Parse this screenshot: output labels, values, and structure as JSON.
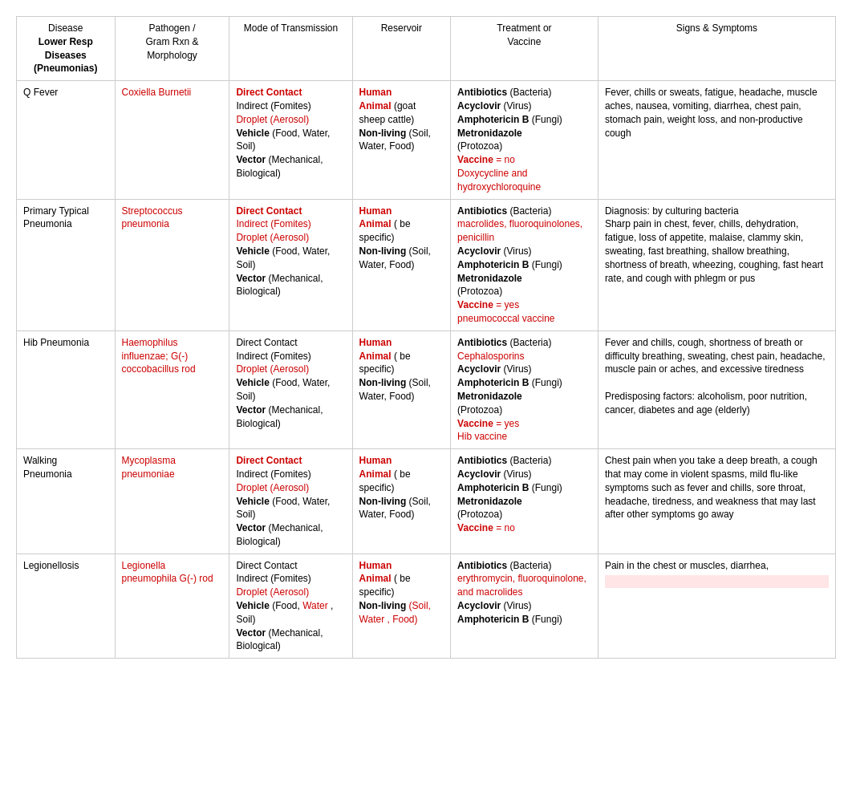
{
  "table": {
    "headers": [
      {
        "id": "disease",
        "line1": "Disease",
        "line2": "Lower Resp Diseases (Pneumonias)"
      },
      {
        "id": "pathogen",
        "line1": "Pathogen /",
        "line2": "Gram Rxn &",
        "line3": "Morphology"
      },
      {
        "id": "transmission",
        "line1": "Mode of Transmission"
      },
      {
        "id": "reservoir",
        "line1": "Reservoir"
      },
      {
        "id": "treatment",
        "line1": "Treatment or",
        "line2": "Vaccine"
      },
      {
        "id": "signs",
        "line1": "Signs & Symptoms"
      }
    ],
    "rows": [
      {
        "disease": "Q Fever",
        "pathogen": "Coxiella Burnetii",
        "transmission": {
          "direct": "Direct Contact",
          "indirect": "Indirect (Fomites)",
          "droplet": "Droplet (Aerosol)",
          "vehicle": "Vehicle (Food, Water, Soil)",
          "vector": "Vector (Mechanical, Biological)"
        },
        "reservoir": {
          "human": "Human",
          "animal": "Animal (goat sheep cattle)",
          "nonliving": "Non-living (Soil, Water, Food)"
        },
        "treatment": {
          "antibiotics": "Antibiotics",
          "antibiotics_type": "(Bacteria)",
          "acyclovir": "Acyclovir",
          "acyclovir_type": "(Virus)",
          "amphotericin": "Amphotericin B",
          "amphotericin_type": "(Fungi)",
          "metronidazole": "Metronidazole",
          "metronidazole_type": "(Protozoa)",
          "vaccine_label": "Vaccine",
          "vaccine_value": "= no",
          "vaccine_extra": "Doxycycline and hydroxychloroquine"
        },
        "signs": "Fever, chills or sweats, fatigue, headache, muscle aches, nausea, vomiting, diarrhea, chest pain, stomach pain, weight loss, and non-productive cough"
      },
      {
        "disease": "Primary  Typical Pneumonia",
        "pathogen": "Streptococcus pneumonia",
        "transmission": {
          "direct": "Direct Contact",
          "indirect": "Indirect (Fomites)",
          "droplet": "Droplet (Aerosol)",
          "vehicle": "Vehicle (Food, Water, Soil)",
          "vector": "Vector (Mechanical, Biological)"
        },
        "reservoir": {
          "human": "Human",
          "animal": "Animal ( be specific)",
          "nonliving": "Non-living (Soil, Water, Food)"
        },
        "treatment": {
          "antibiotics": "Antibiotics",
          "antibiotics_type": "(Bacteria)",
          "antibiotics_detail": "macrolides, fluoroquinolones, penicillin",
          "acyclovir": "Acyclovir",
          "acyclovir_type": "(Virus)",
          "amphotericin": "Amphotericin B",
          "amphotericin_type": "(Fungi)",
          "metronidazole": "Metronidazole",
          "metronidazole_type": "(Protozoa)",
          "vaccine_label": "Vaccine",
          "vaccine_value": "= yes",
          "vaccine_extra": "pneumococcal vaccine"
        },
        "signs": "Diagnosis: by culturing bacteria\nSharp pain in chest, fever, chills, dehydration, fatigue, loss of appetite, malaise, clammy skin, sweating, fast breathing, shallow breathing, shortness of breath, wheezing, coughing, fast heart rate, and cough with phlegm or pus"
      },
      {
        "disease": "Hib Pneumonia",
        "pathogen": "Haemophilus influenzae; G(-) coccobacillus rod",
        "transmission": {
          "direct": "Direct Contact",
          "indirect": "Indirect (Fomites)",
          "droplet": "Droplet (Aerosol)",
          "vehicle": "Vehicle (Food, Water, Soil)",
          "vector": "Vector (Mechanical, Biological)"
        },
        "reservoir": {
          "human": "Human",
          "animal": "Animal ( be specific)",
          "nonliving": "Non-living (Soil, Water, Food)"
        },
        "treatment": {
          "antibiotics": "Antibiotics",
          "antibiotics_type": "(Bacteria)",
          "antibiotics_detail": "Cephalosporins",
          "acyclovir": "Acyclovir",
          "acyclovir_type": "(Virus)",
          "amphotericin": "Amphotericin B",
          "amphotericin_type": "(Fungi)",
          "metronidazole": "Metronidazole",
          "metronidazole_type": "(Protozoa)",
          "vaccine_label": "Vaccine",
          "vaccine_value": "= yes",
          "vaccine_extra": "Hib vaccine"
        },
        "signs": "Fever and chills, cough, shortness of breath or difficulty breathing, sweating, chest pain, headache, muscle pain or aches, and excessive tiredness\n\nPredisposing factors: alcoholism, poor nutrition, cancer, diabetes and age (elderly)"
      },
      {
        "disease": "Walking Pneumonia",
        "pathogen": "Mycoplasma pneumoniae",
        "transmission": {
          "direct": "Direct Contact",
          "indirect": "Indirect (Fomites)",
          "droplet": "Droplet (Aerosol)",
          "vehicle": "Vehicle (Food, Water, Soil)",
          "vector": "Vector (Mechanical, Biological)"
        },
        "reservoir": {
          "human": "Human",
          "animal": "Animal ( be specific)",
          "nonliving": "Non-living (Soil, Water, Food)"
        },
        "treatment": {
          "antibiotics": "Antibiotics",
          "antibiotics_type": "(Bacteria)",
          "acyclovir": "Acyclovir",
          "acyclovir_type": "(Virus)",
          "amphotericin": "Amphotericin B",
          "amphotericin_type": "(Fungi)",
          "metronidazole": "Metronidazole",
          "metronidazole_type": "(Protozoa)",
          "vaccine_label": "Vaccine",
          "vaccine_value": "= no"
        },
        "signs": "Chest pain when you take a deep breath, a cough that may come in violent spasms, mild flu-like symptoms such as fever and chills, sore throat, headache, tiredness, and weakness that may last after other symptoms go away"
      },
      {
        "disease": "Legionellosis",
        "pathogen": "Legionella pneumophila G(-) rod",
        "transmission": {
          "direct": "Direct Contact",
          "indirect": "Indirect (Fomites)",
          "droplet": "Droplet (Aerosol)",
          "vehicle": "Vehicle (Food, Water , Soil)",
          "vector": "Vector (Mechanical, Biological)"
        },
        "reservoir": {
          "human": "Human",
          "animal": "Animal ( be specific)",
          "nonliving": "Non-living (Soil, Water , Food)"
        },
        "treatment": {
          "antibiotics": "Antibiotics",
          "antibiotics_type": "(Bacteria)",
          "antibiotics_detail": "erythromycin, fluoroquinolone, and macrolides",
          "acyclovir": "Acyclovir",
          "acyclovir_type": "(Virus)",
          "amphotericin": "Amphotericin B",
          "amphotericin_type": "(Fungi)"
        },
        "signs": "Pain in the chest or muscles, diarrhea,"
      }
    ]
  }
}
